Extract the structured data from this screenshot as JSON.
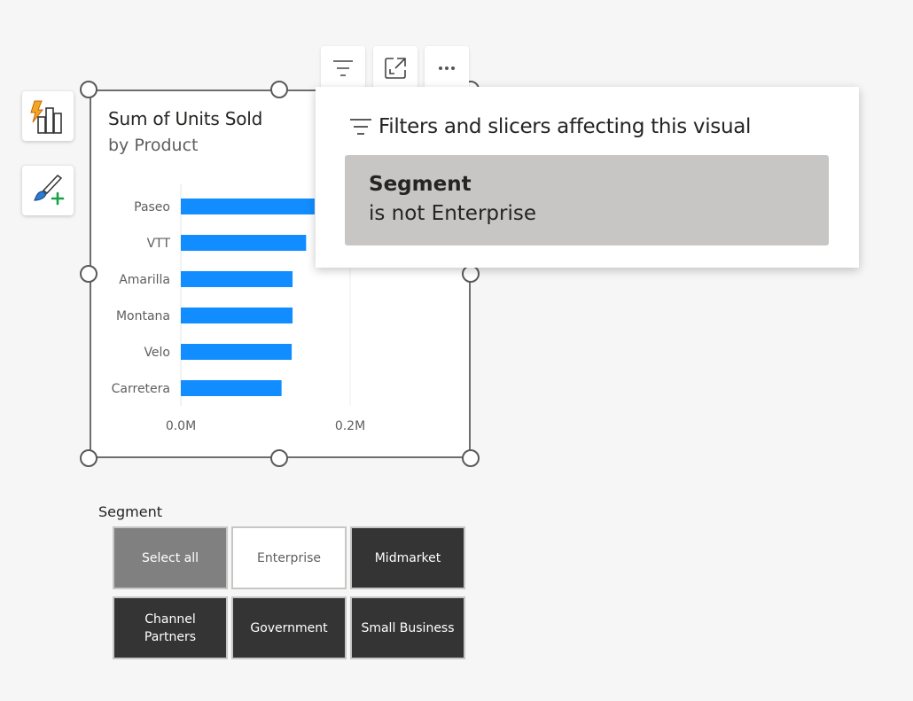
{
  "side_buttons": [
    {
      "name": "quick-insights-icon"
    },
    {
      "name": "format-brush-add-icon"
    }
  ],
  "visual": {
    "title": "Sum of Units Sold",
    "subtitle": "by Product",
    "header_buttons": [
      "filter-icon",
      "focus-mode-icon",
      "more-options-icon"
    ]
  },
  "chart_data": {
    "type": "bar",
    "orientation": "horizontal",
    "title": "Sum of Units Sold",
    "subtitle": "by Product",
    "categories": [
      "Paseo",
      "VTT",
      "Amarilla",
      "Montana",
      "Velo",
      "Carretera"
    ],
    "values": [
      0.158,
      0.148,
      0.132,
      0.132,
      0.131,
      0.119
    ],
    "unit": "M",
    "x_ticks": [
      "0.0M",
      "0.2M"
    ],
    "xlim": [
      0,
      0.3
    ],
    "grid": true,
    "color": "#118dff"
  },
  "filters_popup": {
    "heading": "Filters and slicers affecting this visual",
    "filter": {
      "field": "Segment",
      "condition": "is not Enterprise"
    }
  },
  "slicer": {
    "title": "Segment",
    "options": [
      {
        "label": "Select all",
        "state": "partial"
      },
      {
        "label": "Enterprise",
        "state": "unselected"
      },
      {
        "label": "Midmarket",
        "state": "selected"
      },
      {
        "label": "Channel\nPartners",
        "state": "selected"
      },
      {
        "label": "Government",
        "state": "selected"
      },
      {
        "label": "Small Business",
        "state": "selected"
      }
    ]
  }
}
